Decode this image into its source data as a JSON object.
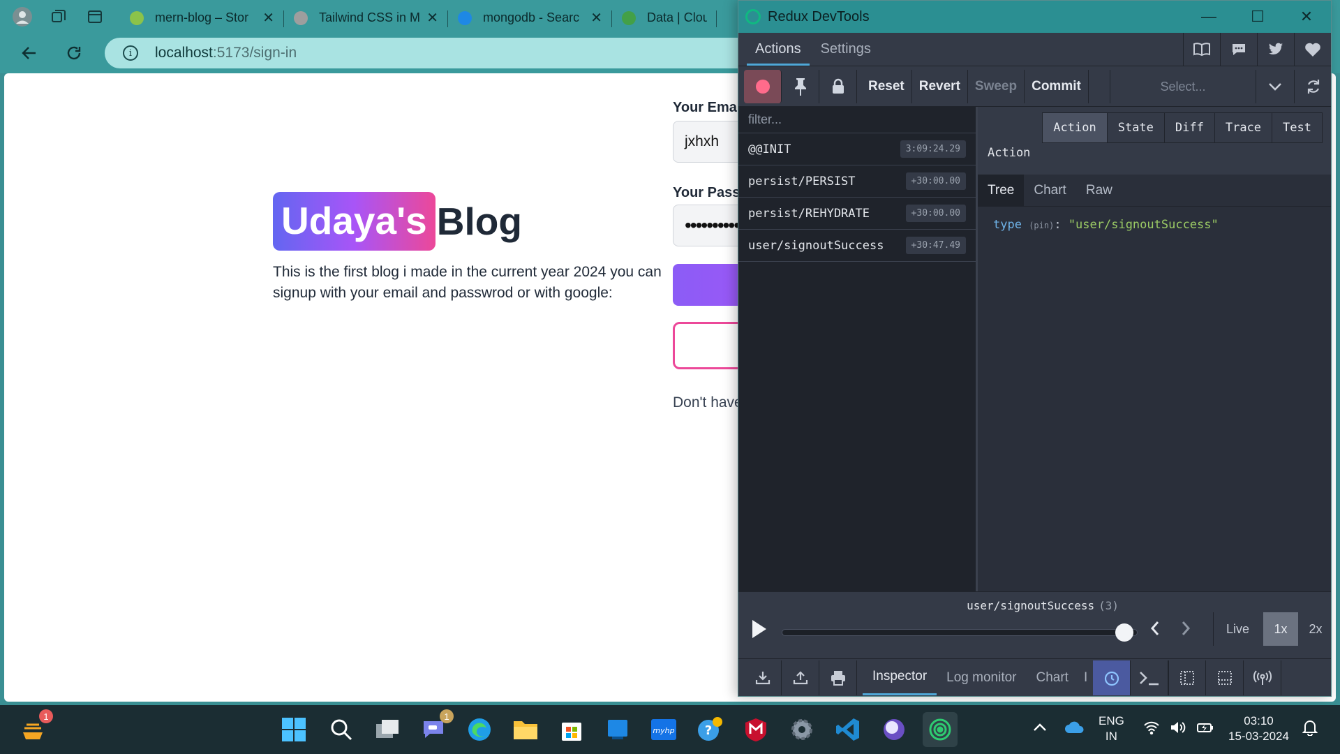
{
  "browser": {
    "tabs": [
      {
        "title": "mern-blog – Stor",
        "color": "#8bc34a"
      },
      {
        "title": "Tailwind CSS in M",
        "color": "#9e9e9e"
      },
      {
        "title": "mongodb - Searc",
        "color": "#1e88e5"
      },
      {
        "title": "Data | Cloud:",
        "color": "#43a047"
      }
    ],
    "url": {
      "host": "localhost",
      "path": ":5173/sign-in"
    }
  },
  "page": {
    "logo_highlight": "Udaya's",
    "logo_rest": "Blog",
    "description": "This is the first blog i made in the current year 2024 you can signup with your email and passwrod or with google:",
    "email_label": "Your Emai",
    "email_value": "jxhxh",
    "password_label": "Your Passw",
    "password_value": "••••••••••",
    "no_account": "Don't have"
  },
  "devtools": {
    "window_title": "Redux DevTools",
    "top_tabs": [
      "Actions",
      "Settings"
    ],
    "toolbar": {
      "reset": "Reset",
      "revert": "Revert",
      "sweep": "Sweep",
      "commit": "Commit",
      "select_placeholder": "Select..."
    },
    "filter_placeholder": "filter...",
    "actions": [
      {
        "name": "@@INIT",
        "time": "3:09:24.29"
      },
      {
        "name": "persist/PERSIST",
        "time": "+30:00.00"
      },
      {
        "name": "persist/REHYDRATE",
        "time": "+30:00.00"
      },
      {
        "name": "user/signoutSuccess",
        "time": "+30:47.49"
      }
    ],
    "inspector_tabs": [
      "Action",
      "State",
      "Diff",
      "Trace",
      "Test"
    ],
    "inspector_label": "Action",
    "view_tabs": [
      "Tree",
      "Chart",
      "Raw"
    ],
    "tree": {
      "key": "type",
      "pin": "(pin)",
      "value": "\"user/signoutSuccess\""
    },
    "slider": {
      "current_action": "user/signoutSuccess",
      "index": "(3)",
      "live": "Live",
      "speed_1x": "1x",
      "speed_2x": "2x"
    },
    "monitor_tabs": [
      "Inspector",
      "Log monitor",
      "Chart",
      "I"
    ]
  },
  "taskbar": {
    "notification_badge": "1",
    "chat_badge": "1",
    "language": "ENG",
    "region": "IN",
    "time": "03:10",
    "date": "15-03-2024"
  }
}
